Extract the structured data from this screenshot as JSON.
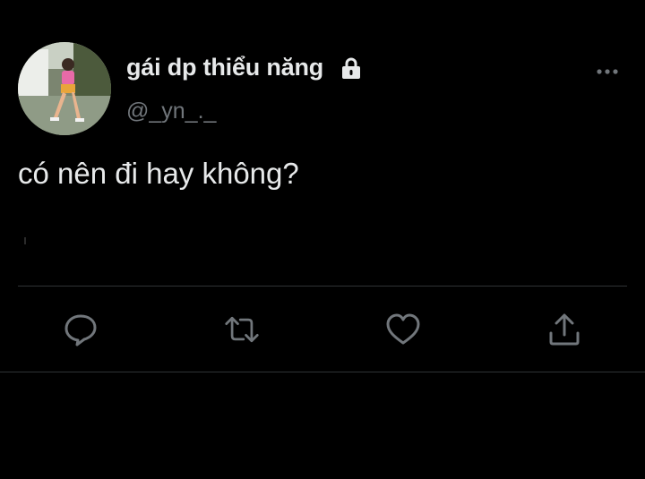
{
  "tweet": {
    "display_name": "gái dp thiểu năng",
    "handle": "@_yn_._",
    "text": "có nên đi hay không?",
    "protected_icon": "lock-icon",
    "more_icon": "more-horizontal-icon"
  },
  "actions": [
    {
      "name": "reply",
      "icon": "reply-icon"
    },
    {
      "name": "retweet",
      "icon": "retweet-icon"
    },
    {
      "name": "like",
      "icon": "heart-icon"
    },
    {
      "name": "share",
      "icon": "share-icon"
    }
  ],
  "colors": {
    "background": "#000000",
    "primary_text": "#e7e9ea",
    "secondary_text": "#71767b",
    "divider": "#2f3336"
  }
}
